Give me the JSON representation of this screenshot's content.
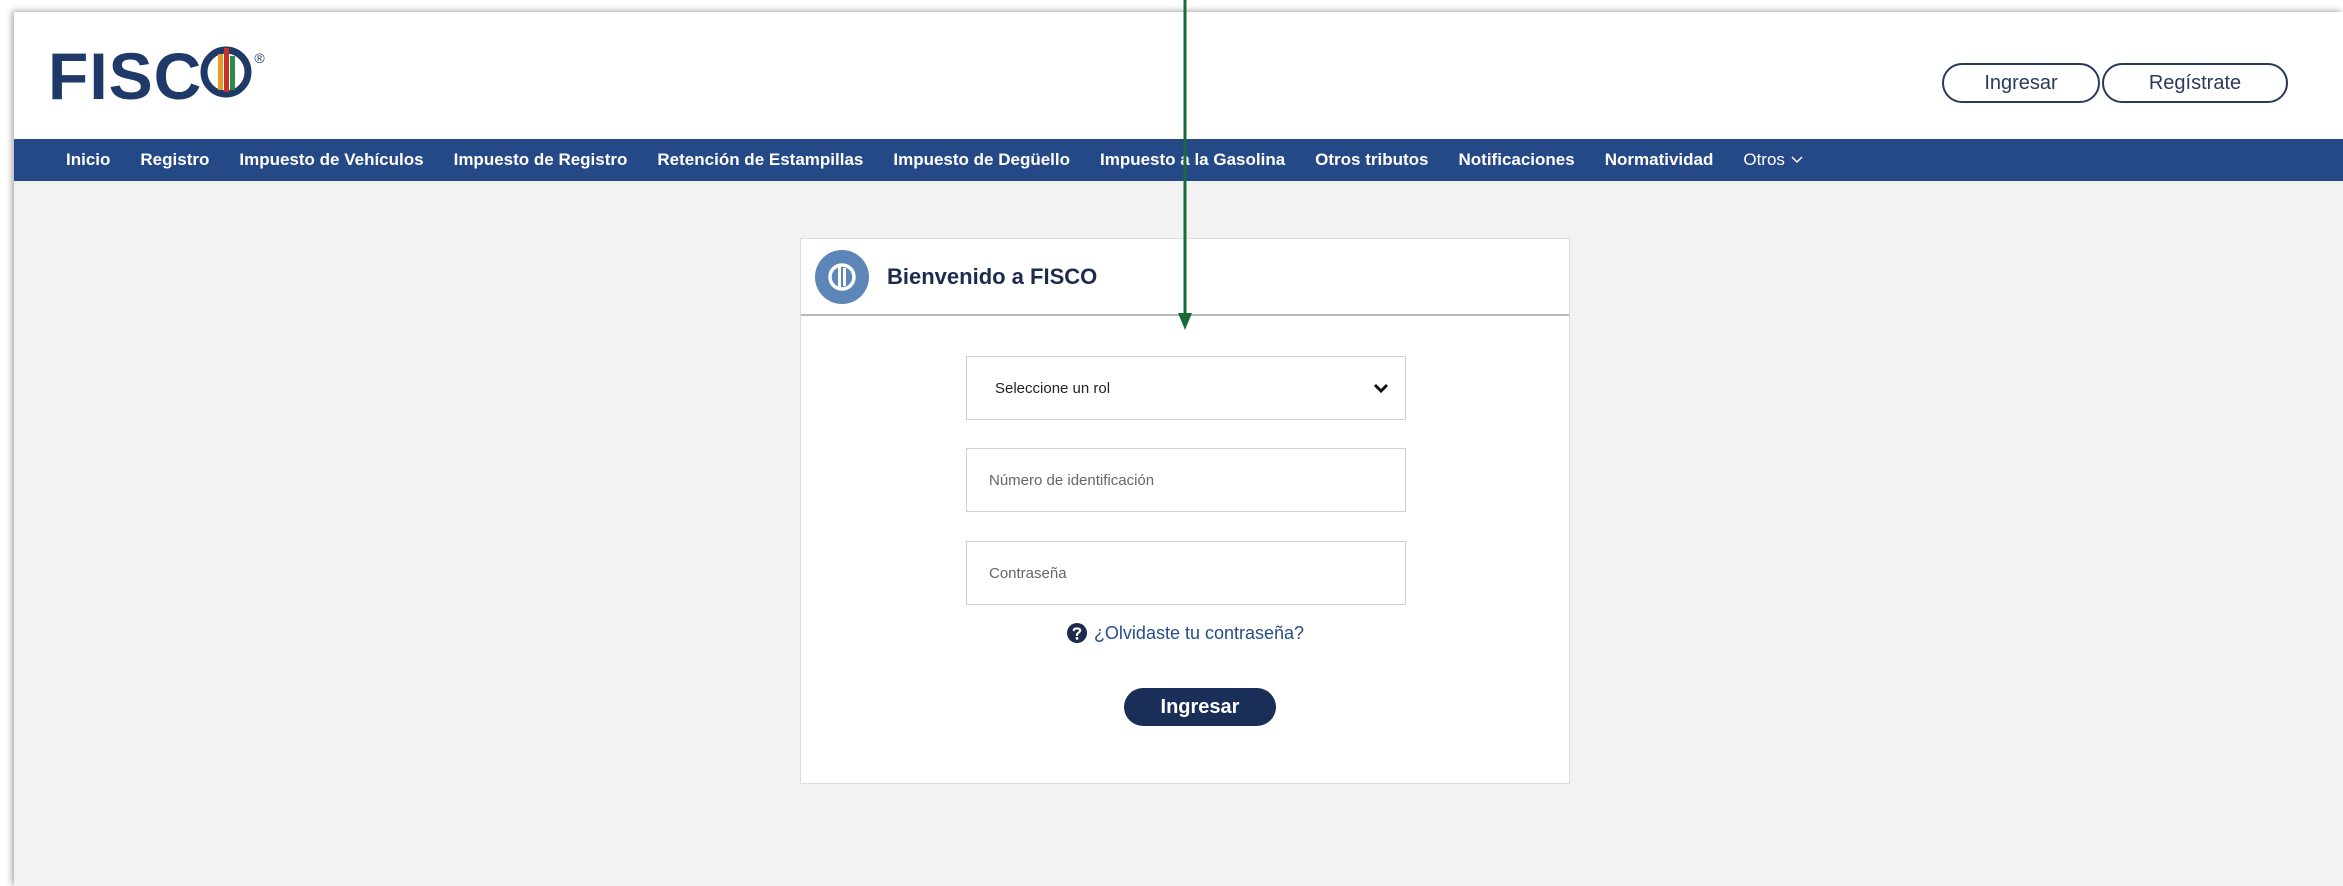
{
  "header": {
    "logo_text": "FISC",
    "logo_mark_icon": "fisco-coin-icon",
    "logo_reg": "®",
    "login_label": "Ingresar",
    "register_label": "Regístrate"
  },
  "nav": {
    "items": [
      "Inicio",
      "Registro",
      "Impuesto de Vehículos",
      "Impuesto de Registro",
      "Retención de Estampillas",
      "Impuesto de Degüello",
      "Impuesto a la Gasolina",
      "Otros tributos",
      "Notificaciones",
      "Normatividad"
    ],
    "more_label": "Otros"
  },
  "login_card": {
    "title": "Bienvenido a FISCO",
    "role_select": {
      "selected": "Seleccione un rol"
    },
    "id_field": {
      "placeholder": "Número de identificación",
      "value": ""
    },
    "password_field": {
      "placeholder": "Contraseña",
      "value": ""
    },
    "forgot_label": "¿Olvidaste tu contraseña?",
    "submit_label": "Ingresar"
  },
  "colors": {
    "nav_bg": "#254986",
    "brand": "#1f3a68",
    "submit_bg": "#1a2f57",
    "annotation_arrow": "#1b6b3a"
  }
}
